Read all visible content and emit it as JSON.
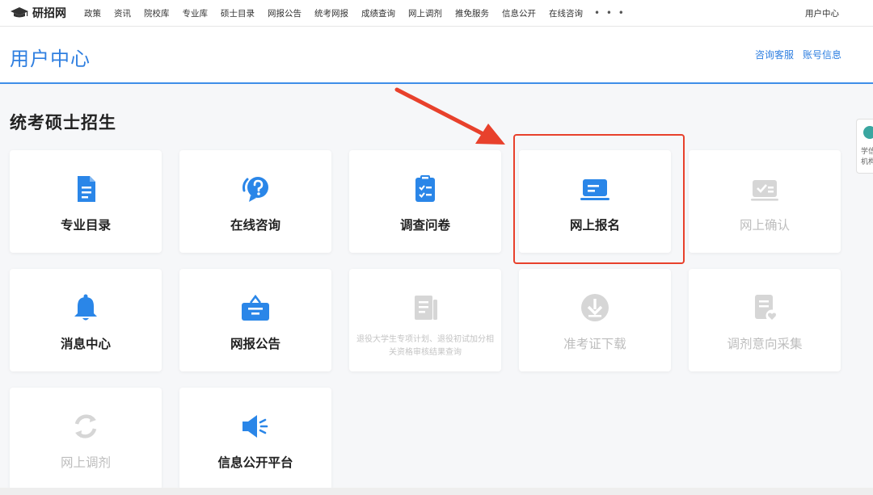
{
  "topnav": {
    "logo_text": "研招网",
    "items": [
      "政策",
      "资讯",
      "院校库",
      "专业库",
      "硕士目录",
      "网报公告",
      "统考网报",
      "成绩查询",
      "网上调剂",
      "推免服务",
      "信息公开",
      "在线咨询"
    ],
    "more": "• • •",
    "user_center": "用户中心"
  },
  "header": {
    "title": "用户中心",
    "links": [
      "咨询客服",
      "账号信息"
    ]
  },
  "section": {
    "title": "统考硕士招生"
  },
  "cards": [
    {
      "label": "专业目录",
      "icon": "document-icon",
      "enabled": true
    },
    {
      "label": "在线咨询",
      "icon": "question-bubble-icon",
      "enabled": true
    },
    {
      "label": "调查问卷",
      "icon": "clipboard-check-icon",
      "enabled": true
    },
    {
      "label": "网上报名",
      "icon": "laptop-icon",
      "enabled": true
    },
    {
      "label": "网上确认",
      "icon": "id-card-check-icon",
      "enabled": false
    },
    {
      "label": "消息中心",
      "icon": "bell-icon",
      "enabled": true
    },
    {
      "label": "网报公告",
      "icon": "bulletin-bag-icon",
      "enabled": true
    },
    {
      "label": "退役大学生专项计划、退役初试加分相关资格审核结果查询",
      "icon": "list-document-icon",
      "enabled": false
    },
    {
      "label": "准考证下载",
      "icon": "download-icon",
      "enabled": false
    },
    {
      "label": "调剂意向采集",
      "icon": "document-heart-icon",
      "enabled": false
    },
    {
      "label": "网上调剂",
      "icon": "refresh-icon",
      "enabled": false
    },
    {
      "label": "信息公开平台",
      "icon": "speaker-icon",
      "enabled": true
    }
  ],
  "side_widget": {
    "text": "学信机构"
  },
  "colors": {
    "accent": "#2f7fe0",
    "icon_blue": "#2a86e8",
    "disabled": "#c4c4c4",
    "highlight": "#e8412c"
  }
}
